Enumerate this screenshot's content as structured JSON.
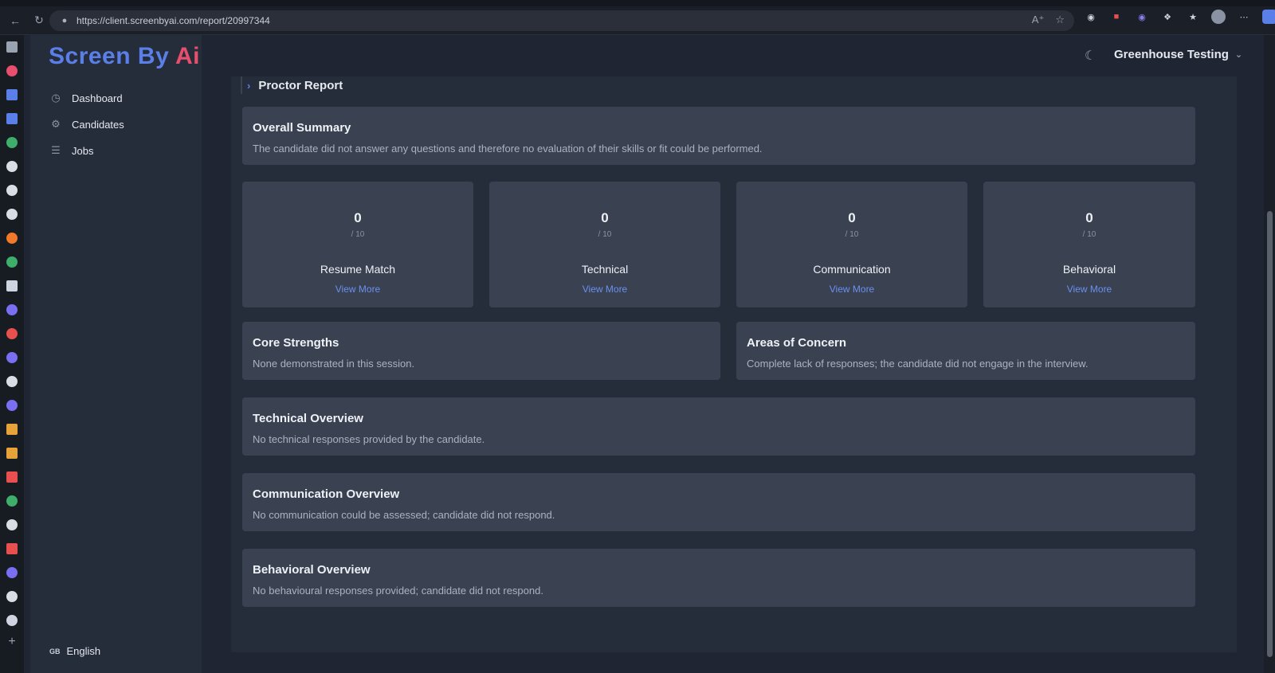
{
  "browser": {
    "url": "https://client.screenbyai.com/report/20997344"
  },
  "app": {
    "logo_part1": "Screen By ",
    "logo_part2": "Ai",
    "org_name": "Greenhouse Testing",
    "language": "English",
    "language_code": "GB"
  },
  "sidebar": {
    "items": [
      {
        "label": "Dashboard",
        "icon": "dashboard-icon"
      },
      {
        "label": "Candidates",
        "icon": "candidates-icon"
      },
      {
        "label": "Jobs",
        "icon": "jobs-icon"
      }
    ]
  },
  "report": {
    "proctor_title": "Proctor Report",
    "overall": {
      "title": "Overall Summary",
      "text": "The candidate did not answer any questions and therefore no evaluation of their skills or fit could be performed."
    },
    "scores": [
      {
        "value": "0",
        "out_of": "/ 10",
        "label": "Resume Match",
        "link": "View More"
      },
      {
        "value": "0",
        "out_of": "/ 10",
        "label": "Technical",
        "link": "View More"
      },
      {
        "value": "0",
        "out_of": "/ 10",
        "label": "Communication",
        "link": "View More"
      },
      {
        "value": "0",
        "out_of": "/ 10",
        "label": "Behavioral",
        "link": "View More"
      }
    ],
    "core_strengths": {
      "title": "Core Strengths",
      "text": "None demonstrated in this session."
    },
    "areas_of_concern": {
      "title": "Areas of Concern",
      "text": "Complete lack of responses; the candidate did not engage in the interview."
    },
    "technical_overview": {
      "title": "Technical Overview",
      "text": "No technical responses provided by the candidate."
    },
    "communication_overview": {
      "title": "Communication Overview",
      "text": "No communication could be assessed; candidate did not respond."
    },
    "behavioral_overview": {
      "title": "Behavioral Overview",
      "text": "No behavioural responses provided; candidate did not respond."
    }
  },
  "colors": {
    "accent_blue": "#5b7fe8",
    "accent_red": "#e84f6e",
    "link": "#6a8ff0",
    "card_bg": "#3a4252",
    "panel_bg": "#262d3a"
  }
}
